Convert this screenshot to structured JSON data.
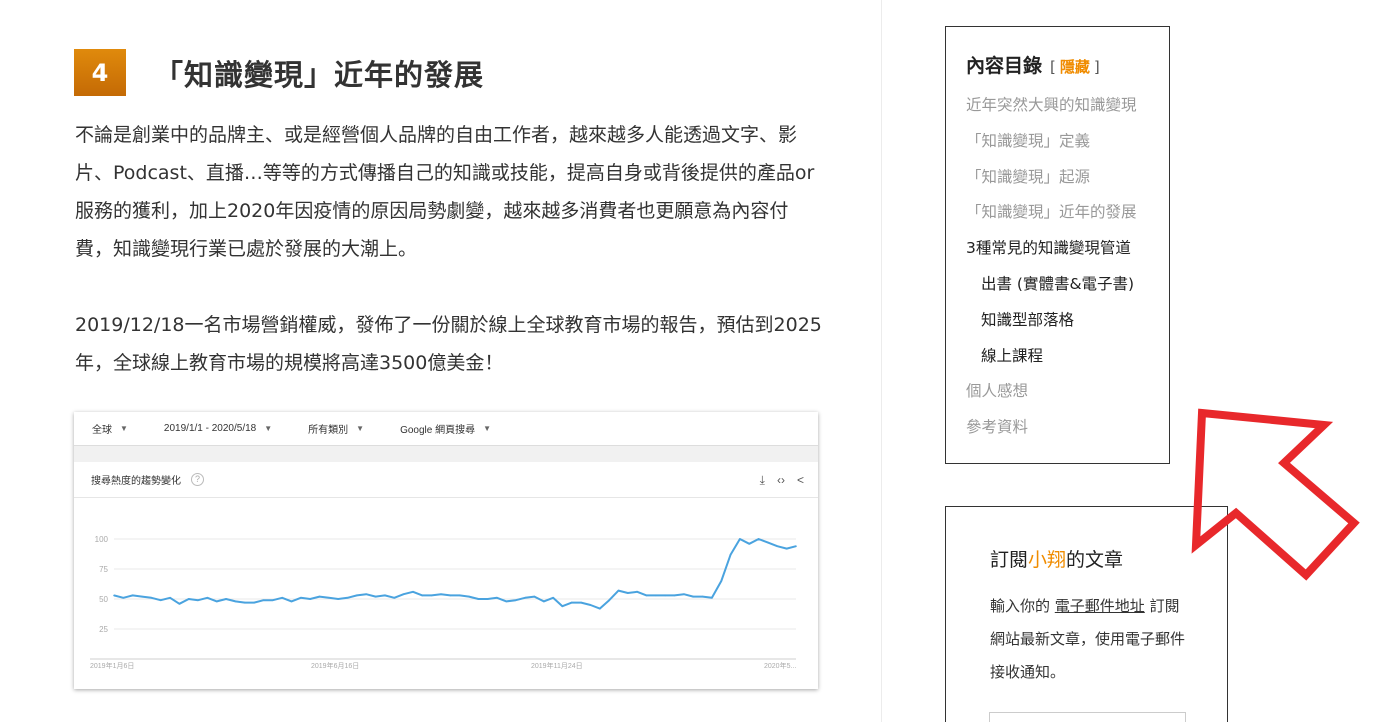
{
  "article": {
    "section_number": "4",
    "section_title": "「知識變現」近年的發展",
    "paragraph1": "不論是創業中的品牌主、或是經營個人品牌的自由工作者，越來越多人能透過文字、影片、Podcast、直播…等等的方式傳播自己的知識或技能，提高自身或背後提供的產品or服務的獲利，加上2020年因疫情的原因局勢劇變，越來越多消費者也更願意為內容付費，知識變現行業已處於發展的大潮上。",
    "paragraph2": "2019/12/18一名市場營銷權威，發佈了一份關於線上全球教育市場的報告，預估到2025年，全球線上教育市場的規模將高達3500億美金！"
  },
  "trends_screenshot": {
    "filters": [
      "全球",
      "2019/1/1 - 2020/5/18",
      "所有類別",
      "Google 網頁搜尋"
    ],
    "panel_title": "搜尋熱度的趨勢變化",
    "help_icon": "?",
    "tool_icons": [
      "download-icon",
      "embed-icon",
      "share-icon"
    ],
    "tool_glyphs": {
      "download": "⤓",
      "embed": "‹›",
      "share": "<"
    },
    "accent_color": "#4aa3df"
  },
  "chart_data": {
    "type": "line",
    "y_ticks": [
      "100",
      "75",
      "50",
      "25"
    ],
    "ylim": [
      0,
      100
    ],
    "x_tick_labels": [
      "2019年1月6日",
      "2019年6月16日",
      "2019年11月24日",
      "2020年5..."
    ],
    "series": [
      {
        "values": [
          53,
          51,
          53,
          52,
          51,
          49,
          51,
          46,
          50,
          49,
          51,
          48,
          50,
          48,
          47,
          47,
          49,
          49,
          51,
          48,
          51,
          50,
          52,
          51,
          50,
          51,
          53,
          54,
          52,
          53,
          51,
          54,
          56,
          53,
          53,
          54,
          53,
          53,
          52,
          50,
          50,
          51,
          48,
          49,
          51,
          52,
          48,
          51,
          44,
          47,
          47,
          45,
          42,
          49,
          57,
          55,
          56,
          53,
          53,
          53,
          53,
          54,
          52,
          52,
          51,
          65,
          87,
          100,
          96,
          100,
          97,
          94,
          92,
          94
        ]
      }
    ]
  },
  "toc": {
    "title": "內容目錄",
    "bracket_open": "[",
    "toggle_label": "隱藏",
    "bracket_close": "]",
    "items": [
      {
        "label": "近年突然大興的知識變現",
        "level": 1,
        "active": false
      },
      {
        "label": "「知識變現」定義",
        "level": 1,
        "active": false
      },
      {
        "label": "「知識變現」起源",
        "level": 1,
        "active": false
      },
      {
        "label": "「知識變現」近年的發展",
        "level": 1,
        "active": false
      },
      {
        "label": "3種常見的知識變現管道",
        "level": 1,
        "active": true
      },
      {
        "label": "出書 (實體書&電子書)",
        "level": 2,
        "active": true
      },
      {
        "label": "知識型部落格",
        "level": 2,
        "active": true
      },
      {
        "label": "線上課程",
        "level": 2,
        "active": true
      },
      {
        "label": "個人感想",
        "level": 1,
        "active": false
      },
      {
        "label": "參考資料",
        "level": 1,
        "active": false
      }
    ]
  },
  "subscribe": {
    "title_prefix": "訂閱",
    "title_highlight": "小翔",
    "title_suffix": "的文章",
    "text_before": "輸入你的 ",
    "text_link": "電子郵件地址",
    "text_after": " 訂閱網站最新文章，使用電子郵件接收通知。"
  },
  "colors": {
    "accent_orange": "#f08c00",
    "arrow_red": "#e8282b",
    "line_blue": "#4aa3df"
  }
}
